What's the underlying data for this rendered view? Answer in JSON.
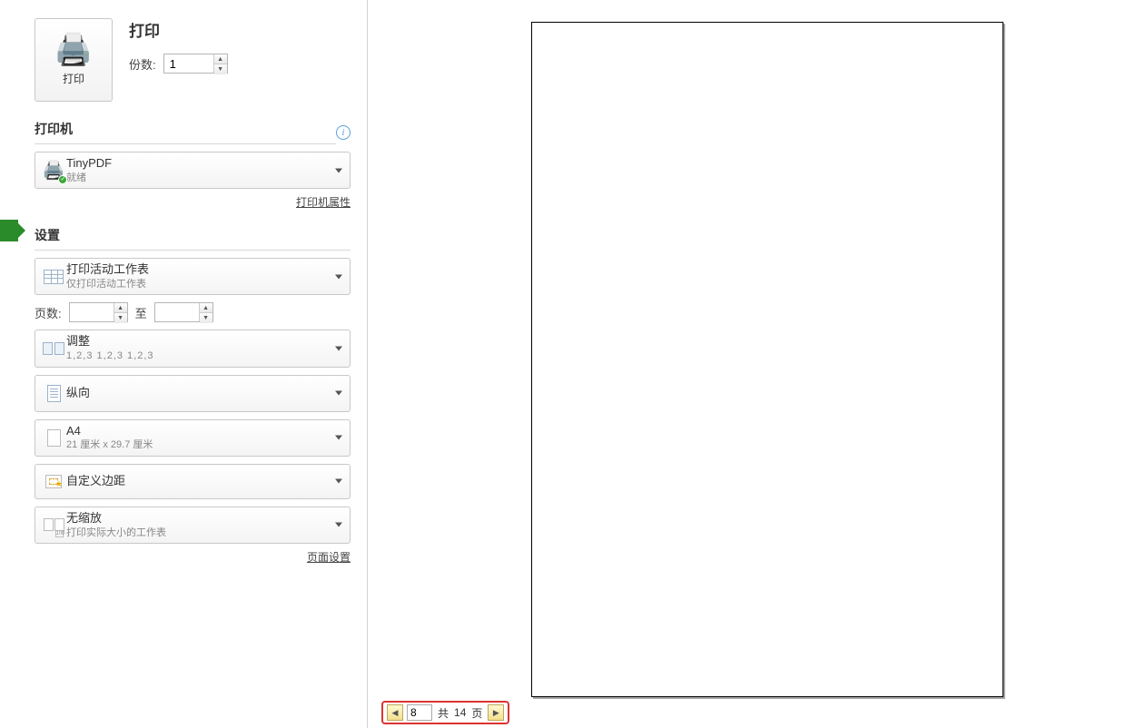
{
  "print_heading": "打印",
  "print_button_label": "打印",
  "copies": {
    "label": "份数:",
    "value": "1"
  },
  "printer": {
    "section_label": "打印机",
    "name": "TinyPDF",
    "status": "就绪",
    "properties_link": "打印机属性"
  },
  "settings": {
    "section_label": "设置",
    "print_what": {
      "main": "打印活动工作表",
      "sub": "仅打印活动工作表"
    },
    "pages": {
      "label": "页数:",
      "from": "",
      "to_label": "至",
      "to": ""
    },
    "collate": {
      "main": "调整",
      "sub": "1,2,3    1,2,3    1,2,3"
    },
    "orientation": {
      "main": "纵向"
    },
    "paper": {
      "main": "A4",
      "sub": "21 厘米 x 29.7 厘米"
    },
    "margins": {
      "main": "自定义边距"
    },
    "scaling": {
      "main": "无缩放",
      "sub": "打印实际大小的工作表"
    },
    "page_setup_link": "页面设置"
  },
  "nav": {
    "current": "8",
    "total_prefix": "共 ",
    "total": "14",
    "total_suffix": " 页"
  }
}
